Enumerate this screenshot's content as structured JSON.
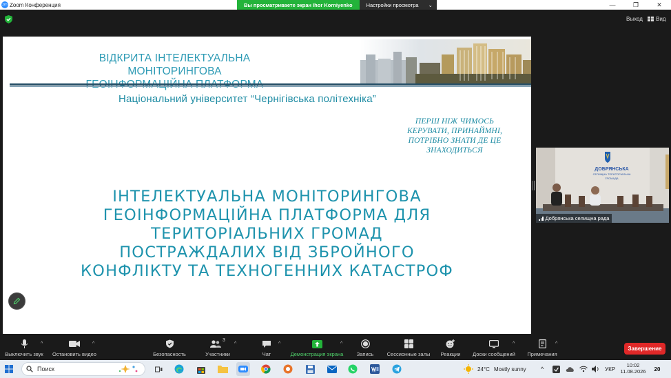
{
  "window": {
    "app_title": "Zoom Конференция",
    "app_icon_text": "zm",
    "controls": [
      "—",
      "❐",
      "✕"
    ]
  },
  "share_banner": {
    "viewing_text": "Вы просматриваете экран Ihor Korniyenko",
    "view_settings": "Настройки просмотра",
    "caret": "⌄"
  },
  "topbar": {
    "exit_label": "Выход",
    "view_label": "Вид"
  },
  "slide": {
    "header_title_line1": "ВІДКРИТА ІНТЕЛЕКТУАЛЬНА МОНІТОРИНГОВА",
    "header_title_line2": "ГЕОІНФОРМАЦІЙНА ПЛАТФОРМА",
    "university": "Національний університет “Чернігівська політехніка”",
    "quote_line1": "ПЕРШ НІЖ ЧИМОСЬ",
    "quote_line2": "КЕРУВАТИ, ПРИНАЙМНІ,",
    "quote_line3": "ПОТРІБНО ЗНАТИ ДЕ ЦЕ",
    "quote_line4": "ЗНАХОДИТЬСЯ",
    "main_line1": "ІНТЕЛЕКТУАЛЬНА МОНІТОРИНГОВА",
    "main_line2": "ГЕОІНФОРМАЦІЙНА ПЛАТФОРМА ДЛЯ",
    "main_line3": "ТЕРИТОРІАЛЬНИХ ГРОМАД",
    "main_line4": "ПОСТРАЖДАЛИХ ВІД ЗБРОЙНОГО",
    "main_line5": "КОНФЛІКТУ ТА ТЕХНОГЕННИХ КАТАСТРОФ"
  },
  "video": {
    "participant_name": "Добрянська селищна рада",
    "wall_text_line1": "ДОБРЯНСЬКА",
    "wall_text_line2": "СЕЛИЩНА ТЕРИТОРІАЛЬНА",
    "wall_text_line3": "ГРОМАДА"
  },
  "toolbar": {
    "mute": "Выключить звук",
    "stop_video": "Остановить видео",
    "security": "Безопасность",
    "participants": "Участники",
    "participants_count": "3",
    "chat": "Чат",
    "share_screen": "Демонстрация экрана",
    "record": "Запись",
    "breakout": "Сессионные залы",
    "reactions": "Реакции",
    "whiteboards": "Доски сообщений",
    "notes": "Примечания",
    "end": "Завершение",
    "caret": "^"
  },
  "taskbar": {
    "search_placeholder": "Поиск",
    "weather_temp": "24°C",
    "weather_text": "Mostly sunny",
    "language": "УКР",
    "time": "10:02",
    "date": "11.08.2026",
    "notifications_count": "20"
  },
  "colors": {
    "teal_text": "#1e93ad",
    "slide_rule": "#254e66",
    "share_green": "#23b33a",
    "end_red": "#e02828",
    "zoom_blue": "#2d8cff"
  }
}
